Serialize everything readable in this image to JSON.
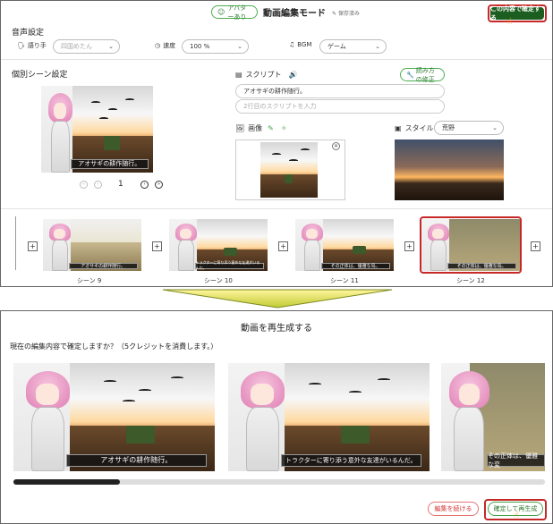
{
  "top": {
    "avatar_badge": "アバターあり",
    "mode_title": "動画編集モード",
    "save_status": "保存済み",
    "confirm_button": "この内容で確定する",
    "audio_section": "音声設定",
    "narrator_label": "語り手",
    "narrator_value": "四国めたん",
    "speed_label": "速度",
    "speed_value": "100 %",
    "bgm_label": "BGM",
    "bgm_value": "ゲーム",
    "scene_section": "個別シーン設定",
    "script_label": "スクリプト",
    "reading_fix_button": "読み方の修正",
    "script_line1": "アオサギの耕作随行。",
    "script_line2_placeholder": "2行目のスクリプトを入力",
    "image_label": "画像",
    "style_label": "スタイル",
    "style_value": "荒野",
    "preview_caption": "アオサギの耕作随行。",
    "page_number": "1",
    "thumbnails": [
      {
        "label": "シーン 9",
        "caption": "アオサギの耕作随行。"
      },
      {
        "label": "シーン 10",
        "caption": "トラクターに寄り添う意外な友達がいるんだ。"
      },
      {
        "label": "シーン 11",
        "caption": "その正体は、優雅な鳥。"
      },
      {
        "label": "シーン 12",
        "caption": "その正体は、優雅な鳥。"
      }
    ]
  },
  "bottom": {
    "title": "動画を再生成する",
    "prompt": "現在の編集内容で確定しますか？（5クレジットを消費します。）",
    "cards": [
      {
        "caption": "アオサギの耕作随行。"
      },
      {
        "caption": "トラクターに寄り添う意外な友達がいるんだ。"
      },
      {
        "caption": "その正体は、優雅な変"
      }
    ],
    "continue_button": "編集を続ける",
    "regenerate_button": "確定して再生成"
  }
}
